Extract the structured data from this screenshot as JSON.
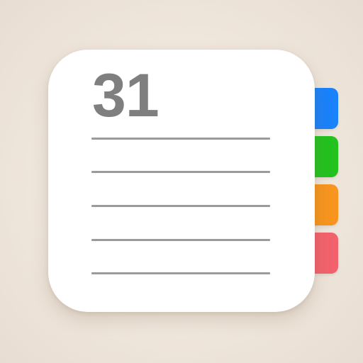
{
  "icon": {
    "date_number": "31",
    "tabs": [
      {
        "name": "blue-tab",
        "color": "#1a82fb"
      },
      {
        "name": "green-tab",
        "color": "#23c21f"
      },
      {
        "name": "orange-tab",
        "color": "#f7951e"
      },
      {
        "name": "red-tab",
        "color": "#f2626c"
      }
    ],
    "page_color": "#ffffff",
    "text_color": "#7f7f7f",
    "rule_color": "#9b9b9b",
    "background_color": "#efe6dc"
  }
}
